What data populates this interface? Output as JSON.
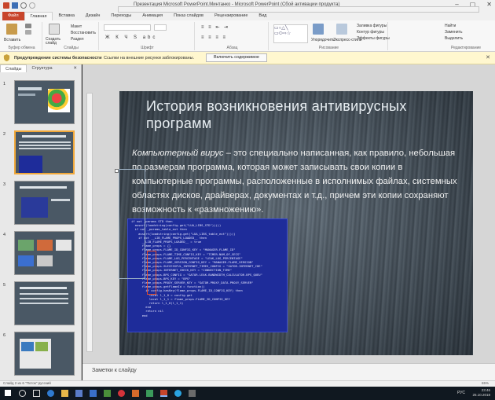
{
  "window": {
    "title": "Презентация Microsoft PowerPoint.Минтанко  -  Microsoft PowerPoint (Сбой активации продукта)",
    "controls": [
      "–",
      "▢",
      "✕"
    ]
  },
  "ribbon_tabs": [
    "Файл",
    "Главная",
    "Вставка",
    "Дизайн",
    "Переходы",
    "Анимация",
    "Показ слайдов",
    "Рецензирование",
    "Вид"
  ],
  "ribbon": {
    "groups": [
      "Буфер обмена",
      "Слайды",
      "Шрифт",
      "Абзац",
      "Рисование",
      "Редактирование"
    ],
    "paste": "Вставить",
    "create_slide": "Создать слайд",
    "layout": "Макет",
    "reset": "Восстановить",
    "section": "Раздел",
    "arrange": "Упорядочить",
    "quick_styles": "Экспресс-стили",
    "shape_fill": "Заливка фигуры",
    "shape_outline": "Контур фигуры",
    "shape_effects": "Эффекты фигуры",
    "find": "Найти",
    "replace": "Заменить",
    "select": "Выделить"
  },
  "security_bar": {
    "title": "Предупреждение системы безопасности",
    "message": "Ссылки на внешние рисунки заблокированы.",
    "button": "Включить содержимое"
  },
  "left_panel": {
    "tabs": [
      "Слайды",
      "Структура"
    ],
    "slide_numbers": [
      "1",
      "2",
      "3",
      "4",
      "5",
      "6"
    ],
    "selected_index": 1
  },
  "slide": {
    "title": "История возникновения антивирусных программ",
    "body_em": "Компьютерный вирус",
    "body_rest": " – это специально написанная, как правило, небольшая по размерам программа, которая может записывать свои копии в компьютерные программы, расположенные в исполнимых файлах, системных областях дисков, драйверах, документах и т.д., причем эти копии сохраняют возможность к «размножению».",
    "code_lines": [
      "if not _params STD then",
      "  assert(loadstring(config.get(\"LUA_LIBS_STD\"))())",
      "  if not _params_table_ext then",
      "    assert(loadstring(config.get(\"LUA_LIBS_table_ext\")))()",
      "    if not __LIB_FLAME_PROPS_LOADED__ then",
      "      __LIB_FLAME_PROPS_LOADED__ = true",
      "      flame_props = {}",
      "      flame_props.FLAME_ID_CONFIG_KEY = \"MANAGER.FLAME_ID\"",
      "      flame_props.FLAME_TIME_CONFIG_KEY = \"TIMER.NUM_OF_SECS\"",
      "      flame_props.FLAME_LOG_PERCENTAGE = \"LEAK_LOG_PERCENTAGE\"",
      "      flame_props.FLAME_VERSION_CONFIG_KEY = \"MANAGER.FLAME_VERSION\"",
      "      flame_props.SUCCESSFUL_INTERNET_TIMES_CONFIG = \"GATOR.INTERNET_CHE\"",
      "      flame_props.INTERNET_CHECK_KEY = \"CONNECTION_TIME\"",
      "      flame_props.BPS_CONFIG = \"GATOR.LEAK.BANDWIDTH_CALCULATOR.BPS_QUEU\"",
      "      flame_props.BPS_KEY = \"BPS\"",
      "      flame_props.PROXY_SERVER_KEY = \"GATOR.PROXY_DATA.PROXY_SERVER\"",
      "      flame_props.getFlameId = function()",
      "        if config.hasKey(flame_props.FLAME_ID_CONFIG_KEY) then",
      "          local l_1_0 = config.get",
      "          local l_1_1 = flame_props.FLAME_ID_CONFIG_KEY",
      "          return l_1_0(l_1_1)",
      "        end",
      "        return nil",
      "      end"
    ]
  },
  "notes_placeholder": "Заметки к слайду",
  "status_bar": {
    "left": "Слайд 2 из 6   \"Поток\"   русский",
    "zoom": "65%"
  },
  "taskbar": {
    "lang": "РУС",
    "time": "23:46",
    "date": "25.10.2018"
  },
  "colors": {
    "file_tab": "#c8452b",
    "security_bar": "#fff7cf",
    "code_bg": "#1e2c9a",
    "selected_thumb": "#f1a83a",
    "taskbar": "#101820"
  }
}
